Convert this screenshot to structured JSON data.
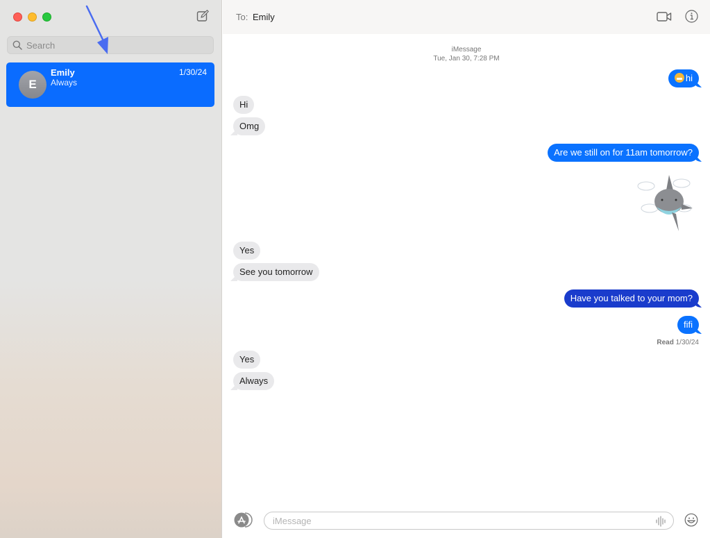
{
  "window": {
    "controls": [
      "close",
      "minimize",
      "maximize"
    ]
  },
  "sidebar": {
    "compose_icon": "compose-icon",
    "search": {
      "placeholder": "Search",
      "value": ""
    },
    "conversations": [
      {
        "initial": "E",
        "name": "Emily",
        "preview": "Always",
        "date": "1/30/24",
        "selected": true
      }
    ]
  },
  "header": {
    "to_label": "To:",
    "recipient": "Emily",
    "icons": [
      "video-call-icon",
      "info-icon"
    ]
  },
  "thread": {
    "service": "iMessage",
    "timestamp": "Tue, Jan 30, 7:28 PM",
    "messages": [
      {
        "direction": "out",
        "emoji": "grimacing-face",
        "text": "hi"
      },
      {
        "direction": "in",
        "text": "Hi"
      },
      {
        "direction": "in",
        "text": "Omg"
      },
      {
        "direction": "out",
        "text": "Are we still on for 11am tomorrow?"
      },
      {
        "direction": "out",
        "type": "sticker",
        "sticker": "shark-in-clouds"
      },
      {
        "direction": "in",
        "text": "Yes"
      },
      {
        "direction": "in",
        "text": "See you tomorrow"
      },
      {
        "direction": "out",
        "text": "Have you talked to your mom?"
      },
      {
        "direction": "out",
        "text": "fifi"
      },
      {
        "direction": "in",
        "text": "Yes"
      },
      {
        "direction": "in",
        "text": "Always"
      }
    ],
    "read_receipt": {
      "label": "Read",
      "date": "1/30/24"
    }
  },
  "composer": {
    "placeholder": "iMessage",
    "value": ""
  },
  "colors": {
    "accent": "#0a6cff",
    "outgoing_bubble": "#0a72ff",
    "outgoing_bubble_alt": "#1a3ccc",
    "incoming_bubble": "#e9e9eb"
  }
}
